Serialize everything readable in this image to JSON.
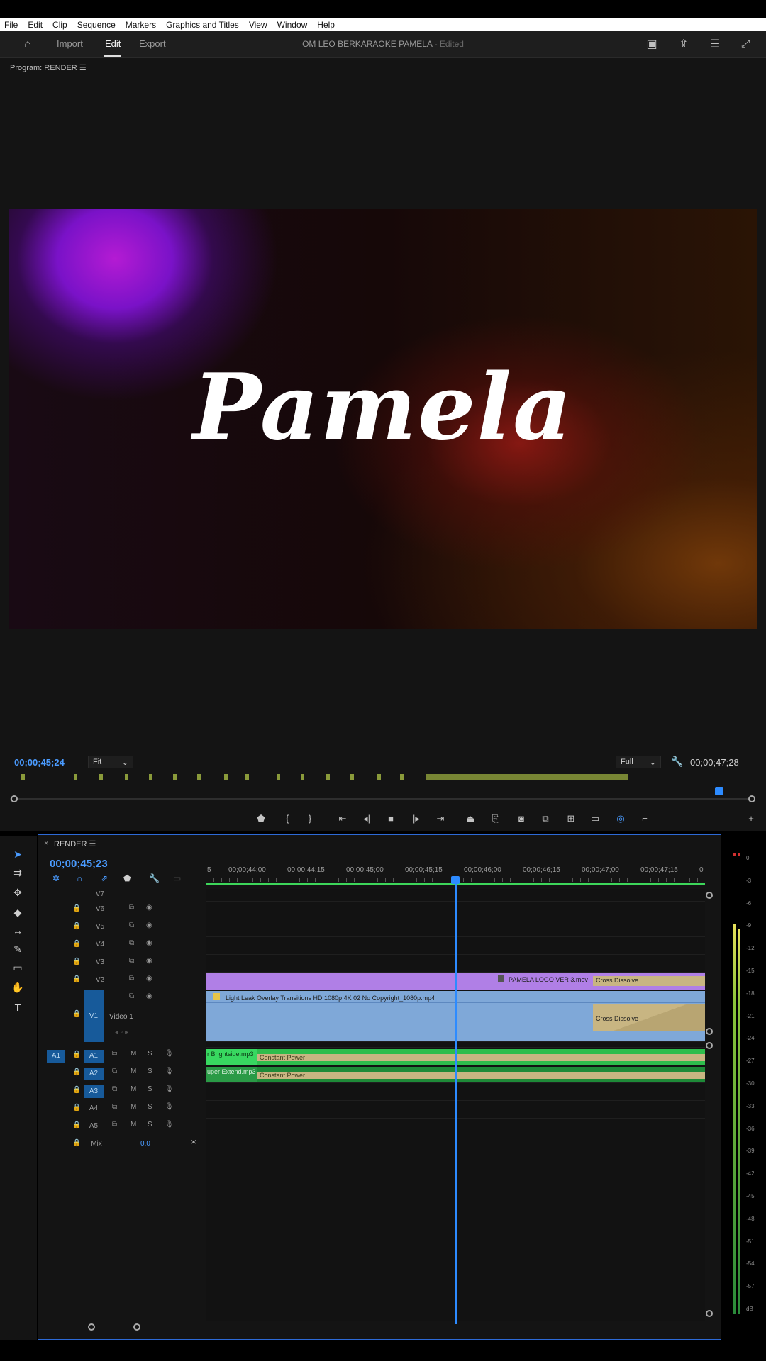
{
  "menu": [
    "File",
    "Edit",
    "Clip",
    "Sequence",
    "Markers",
    "Graphics and Titles",
    "View",
    "Window",
    "Help"
  ],
  "header": {
    "tabs": [
      "Import",
      "Edit",
      "Export"
    ],
    "active": "Edit",
    "project_title": "OM LEO BERKARAOKE PAMELA",
    "edited_label": "- Edited"
  },
  "program": {
    "label": "Program: RENDER",
    "preview_text": "Pamela",
    "timecode_current": "00;00;45;24",
    "timecode_duration": "00;00;47;28",
    "zoom": "Fit",
    "resolution": "Full"
  },
  "timeline": {
    "tab": "RENDER",
    "timecode": "00;00;45;23",
    "ruler": [
      "5",
      "00;00;44;00",
      "00;00;44;15",
      "00;00;45;00",
      "00;00;45;15",
      "00;00;46;00",
      "00;00;46;15",
      "00;00;47;00",
      "00;00;47;15",
      "0"
    ],
    "video_tracks": [
      "V7",
      "V6",
      "V5",
      "V4",
      "V3",
      "V2",
      "V1"
    ],
    "video1_name": "Video 1",
    "audio_tracks": [
      "A1",
      "A2",
      "A3",
      "A4",
      "A5"
    ],
    "mix_label": "Mix",
    "mix_value": "0.0",
    "clips": {
      "v2": "PAMELA LOGO VER 3.mov",
      "v1": "Light Leak Overlay  Transitions  HD 1080p 4K  02 No Copyright_1080p.mp4",
      "transition": "Cross Dissolve",
      "a1": "r Brightside.mp3",
      "a2": "uper Extend.mp3",
      "audio_transition": "Constant Power"
    }
  },
  "meter": {
    "ticks": [
      "0",
      "-3",
      "-6",
      "-9",
      "-12",
      "-15",
      "-18",
      "-21",
      "-24",
      "-27",
      "-30",
      "-33",
      "-36",
      "-39",
      "-42",
      "-45",
      "-48",
      "-51",
      "-54",
      "-57",
      "dB"
    ]
  },
  "colors": {
    "accent": "#2d8bff",
    "video_clip": "#7fa8d8",
    "title_clip": "#b07fe6",
    "audio_clip": "#2ebd4c",
    "transition": "#c8b582"
  }
}
